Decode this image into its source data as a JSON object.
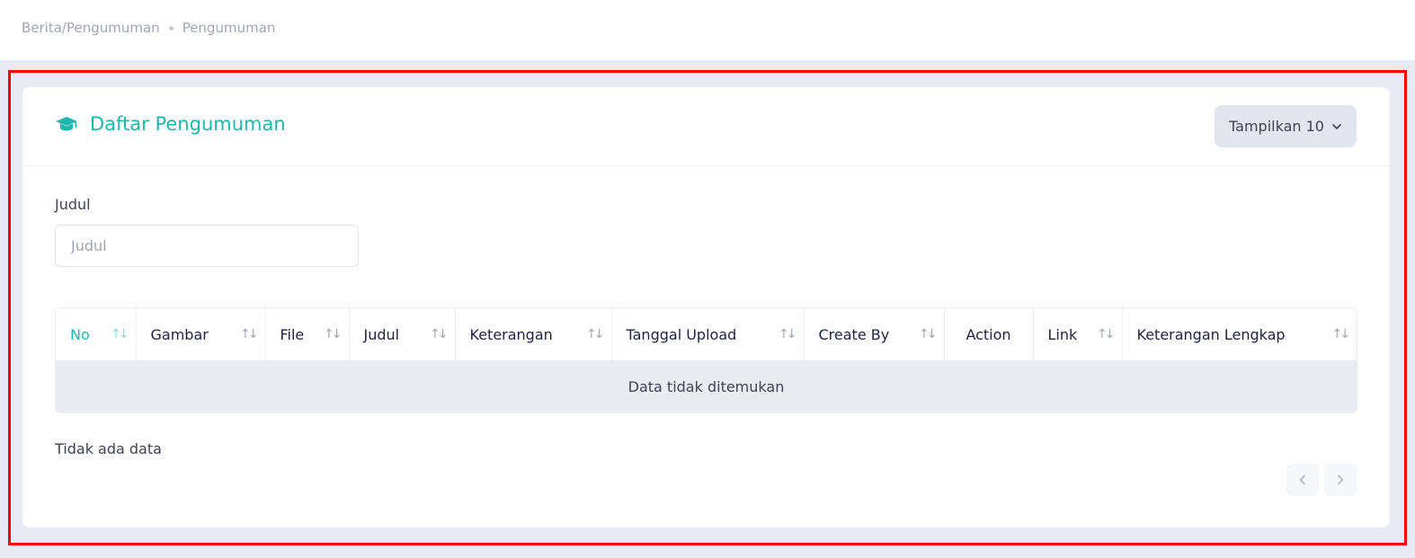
{
  "breadcrumb": {
    "parent": "Berita/Pengumuman",
    "current": "Pengumuman"
  },
  "card": {
    "title": "Daftar Pengumuman",
    "title_icon": "graduation-cap-icon",
    "show_button_label": "Tampilkan 10"
  },
  "filter": {
    "label": "Judul",
    "placeholder": "Judul",
    "value": ""
  },
  "table": {
    "columns": [
      {
        "label": "No",
        "sortable": true,
        "active": true
      },
      {
        "label": "Gambar",
        "sortable": true
      },
      {
        "label": "File",
        "sortable": true
      },
      {
        "label": "Judul",
        "sortable": true
      },
      {
        "label": "Keterangan",
        "sortable": true
      },
      {
        "label": "Tanggal Upload",
        "sortable": true
      },
      {
        "label": "Create By",
        "sortable": true
      },
      {
        "label": "Action",
        "sortable": false
      },
      {
        "label": "Link",
        "sortable": true
      },
      {
        "label": "Keterangan Lengkap",
        "sortable": true
      }
    ],
    "empty_message": "Data tidak ditemukan"
  },
  "footer": {
    "info": "Tidak ada data"
  },
  "colors": {
    "accent": "#1fb7ac",
    "highlight_border": "#ff0000",
    "page_background": "#e9eaf3"
  }
}
